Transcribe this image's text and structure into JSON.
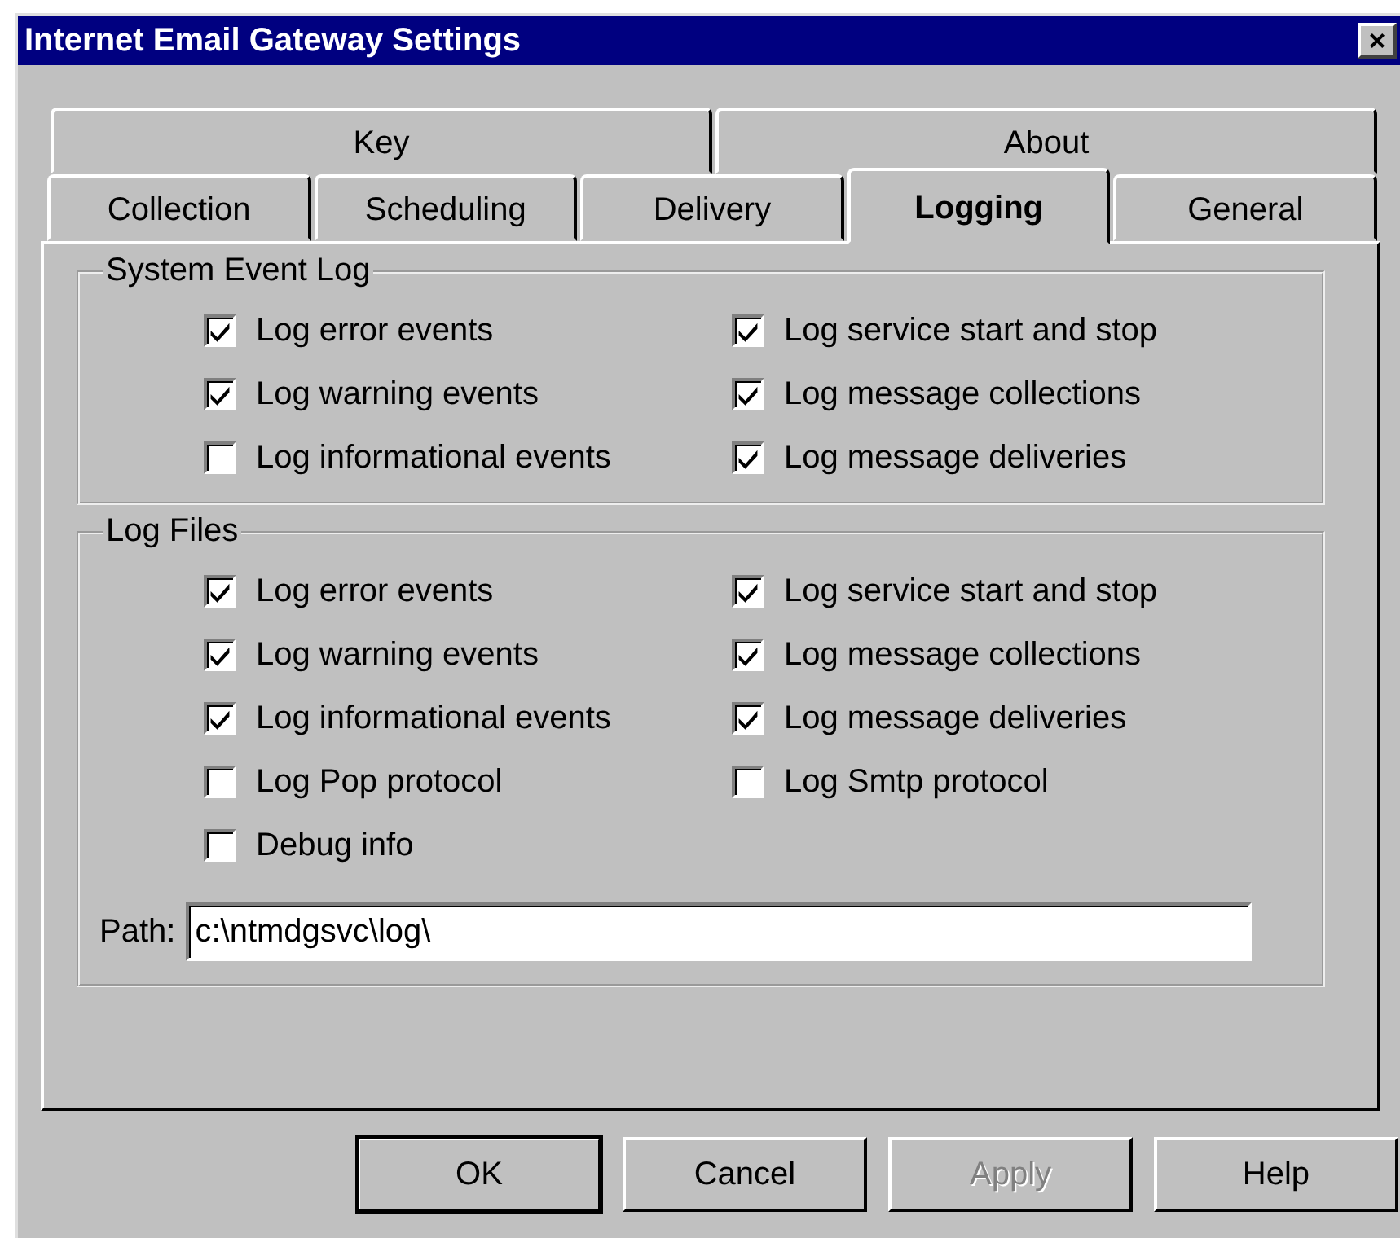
{
  "window": {
    "title": "Internet Email Gateway Settings",
    "close": "×"
  },
  "tab_rows": [
    [
      {
        "label": "Key",
        "selected": false
      },
      {
        "label": "About",
        "selected": false
      }
    ],
    [
      {
        "label": "Collection",
        "selected": false
      },
      {
        "label": "Scheduling",
        "selected": false
      },
      {
        "label": "Delivery",
        "selected": false
      },
      {
        "label": "Logging",
        "selected": true
      },
      {
        "label": "General",
        "selected": false
      }
    ]
  ],
  "groups": [
    {
      "title": "System Event Log",
      "items": [
        {
          "label": "Log error events",
          "checked": true
        },
        {
          "label": "Log service start and stop",
          "checked": true
        },
        {
          "label": "Log warning events",
          "checked": true
        },
        {
          "label": "Log message collections",
          "checked": true
        },
        {
          "label": "Log informational events",
          "checked": false
        },
        {
          "label": "Log message deliveries",
          "checked": true
        }
      ]
    },
    {
      "title": "Log Files",
      "items": [
        {
          "label": "Log error events",
          "checked": true
        },
        {
          "label": "Log service start and stop",
          "checked": true
        },
        {
          "label": "Log warning events",
          "checked": true
        },
        {
          "label": "Log message collections",
          "checked": true
        },
        {
          "label": "Log informational events",
          "checked": true
        },
        {
          "label": "Log message deliveries",
          "checked": true
        },
        {
          "label": "Log Pop protocol",
          "checked": false
        },
        {
          "label": "Log Smtp protocol",
          "checked": false
        },
        {
          "label": "Debug info",
          "checked": false
        }
      ],
      "path": {
        "label": "Path:",
        "value": "c:\\ntmdgsvc\\log\\"
      }
    }
  ],
  "buttons": [
    {
      "label": "OK",
      "default": true,
      "disabled": false
    },
    {
      "label": "Cancel",
      "default": false,
      "disabled": false
    },
    {
      "label": "Apply",
      "default": false,
      "disabled": true
    },
    {
      "label": "Help",
      "default": false,
      "disabled": false
    }
  ]
}
